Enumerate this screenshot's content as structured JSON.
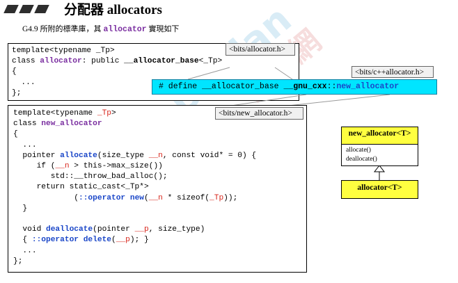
{
  "heading": {
    "cjk": "分配器",
    "latin": "allocators"
  },
  "subtitle": {
    "figure_no": "G4.9",
    "text_before": "所附的標準庫，其",
    "code": "allocator",
    "text_after": "實現如下"
  },
  "tags": {
    "allocator_h": "<bits/allocator.h>",
    "cpp_allocator_h": "<bits/c++allocator.h>",
    "new_allocator_h": "<bits/new_allocator.h>"
  },
  "box1": {
    "line1": "template<typename _Tp>",
    "line2": {
      "a": "class ",
      "b": "allocator",
      "c": ": public ",
      "d": "__allocator_base",
      "e": "<_Tp>"
    },
    "line3": "{",
    "line4": "  ...",
    "line5": "};"
  },
  "define": {
    "a": "# define __allocator_base ",
    "b": "__gnu_cxx",
    "c": "::",
    "d": "new_allocator"
  },
  "box2": {
    "l1a": "template<typename ",
    "l1b": "_Tp",
    "l1c": ">",
    "l2a": "class ",
    "l2b": "new_allocator",
    "l3": "{",
    "l4": "  ...",
    "l5a": "  pointer ",
    "l5b": "allocate",
    "l5c": "(size_type ",
    "l5d": "__n",
    "l5e": ", const void* = 0) {",
    "l6a": "     if (",
    "l6b": "__n",
    "l6c": " > this->max_size())",
    "l7": "        std::__throw_bad_alloc();",
    "l8": "     return static_cast<_Tp*>",
    "l9a": "             (",
    "l9b": "::operator new",
    "l9c": "(",
    "l9d": "__n",
    "l9e": " * sizeof(",
    "l9f": "_Tp",
    "l9g": "));",
    "l10": "  }",
    "l12a": "  void ",
    "l12b": "deallocate",
    "l12c": "(pointer ",
    "l12d": "__p",
    "l12e": ", size_type)",
    "l13a": "  { ",
    "l13b": "::operator delete",
    "l13c": "(",
    "l13d": "__p",
    "l13e": "); }",
    "l14": "  ...",
    "l15": "};"
  },
  "uml": {
    "top_title": "new_allocator<T>",
    "op1": "allocate()",
    "op2": "deallocate()",
    "bottom_title": "allocator<T>"
  },
  "watermark": {
    "text1": "Boolan",
    "text2": "博覽網"
  },
  "colors": {
    "keyword_purple": "#7a2ea0",
    "function_blue": "#1a46c8",
    "param_red": "#d8261c",
    "define_cyan": "#00e5ff",
    "uml_yellow": "#ffff40"
  }
}
